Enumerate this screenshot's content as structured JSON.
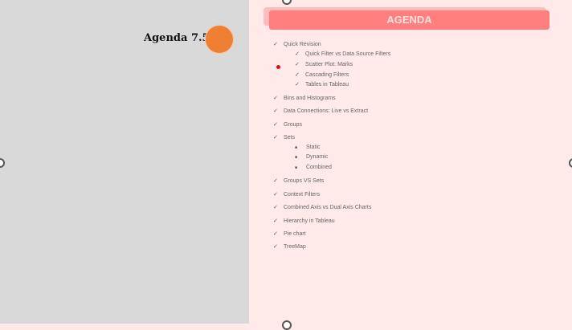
{
  "slide_title": "Agenda 7.5",
  "banner": "AGENDA",
  "items": [
    {
      "label": "Quick Revision",
      "level": "top"
    },
    {
      "label": "Quick Filter vs Data Source Filters",
      "level": "sub"
    },
    {
      "label": "Scatter Plot: Marks",
      "level": "sub"
    },
    {
      "label": "Cascading Filters",
      "level": "sub"
    },
    {
      "label": "Tables in Tableau",
      "level": "sub"
    },
    {
      "label": "Bins and Histograms",
      "level": "top"
    },
    {
      "label": "Data Connections: Live vs Extract",
      "level": "top"
    },
    {
      "label": "Groups",
      "level": "top"
    },
    {
      "label": "Sets",
      "level": "top"
    },
    {
      "label": "Static",
      "level": "bul"
    },
    {
      "label": "Dynamic",
      "level": "bul"
    },
    {
      "label": "Combined",
      "level": "bul"
    },
    {
      "label": "Groups VS Sets",
      "level": "top"
    },
    {
      "label": "Context Filters",
      "level": "top"
    },
    {
      "label": "Combined Axis vs Dual Axis Charts",
      "level": "top"
    },
    {
      "label": "Hierarchy in Tableau",
      "level": "top"
    },
    {
      "label": "Pie chart",
      "level": "top"
    },
    {
      "label": "TreeMap",
      "level": "top"
    }
  ],
  "colors": {
    "accent": "#ff7f7f",
    "circle": "#ef8033",
    "bg": "#ffe9e9"
  }
}
